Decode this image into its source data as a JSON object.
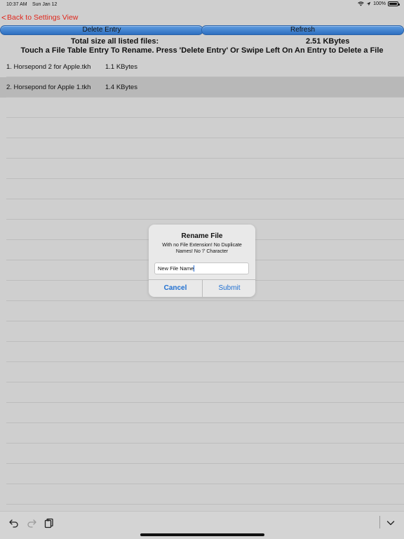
{
  "status_bar": {
    "time": "10:37 AM",
    "date": "Sun Jan 12",
    "battery": "100%",
    "battery_level": 1.0
  },
  "navigation": {
    "back_label": "Back to Settings View"
  },
  "buttons": {
    "delete_label": "Delete Entry",
    "refresh_label": "Refresh"
  },
  "summary": {
    "label": "Total size all listed files:",
    "value": "2.51 KBytes"
  },
  "instruction": "Touch a File Table Entry To Rename. Press 'Delete Entry' Or Swipe Left On An Entry to Delete a File",
  "files": [
    {
      "name": "1.  Horsepond 2 for Apple.tkh",
      "size": "1.1 KBytes"
    },
    {
      "name": "2.  Horsepond for Apple 1.tkh",
      "size": "1.4 KBytes"
    }
  ],
  "dialog": {
    "title": "Rename File",
    "message": "With no File Extension! No Duplicate Names! No '/' Character",
    "input_value": "New File Name",
    "cancel_label": "Cancel",
    "submit_label": "Submit"
  },
  "colors": {
    "accent_red": "#e0261b",
    "button_blue": "#3d7fcc",
    "dialog_blue": "#1f6fd1"
  },
  "toolbar": {
    "icons": [
      "undo-icon",
      "redo-icon",
      "paste-icon",
      "chevron-down-icon"
    ]
  }
}
